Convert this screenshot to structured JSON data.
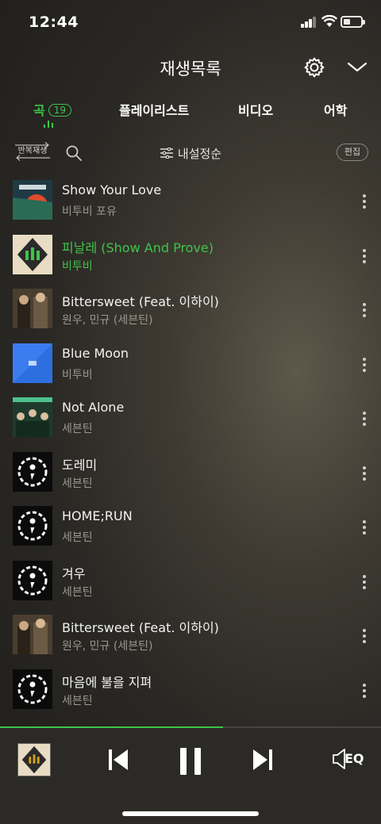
{
  "status": {
    "time": "12:44"
  },
  "header": {
    "title": "재생목록"
  },
  "tabs": [
    {
      "label": "곡",
      "count": "19"
    },
    {
      "label": "플레이리스트"
    },
    {
      "label": "비디오"
    },
    {
      "label": "어학"
    }
  ],
  "toolbar": {
    "repeat_label": "반복재생",
    "sort_label": "내설정순",
    "edit_label": "편집"
  },
  "songs": [
    {
      "title": "Show Your Love",
      "artist": "비투비 포유"
    },
    {
      "title": "피날레 (Show And Prove)",
      "artist": "비투비"
    },
    {
      "title": "Bittersweet (Feat. 이하이)",
      "artist": "원우, 민규 (세븐틴)"
    },
    {
      "title": "Blue Moon",
      "artist": "비투비"
    },
    {
      "title": "Not Alone",
      "artist": "세븐틴"
    },
    {
      "title": "도레미",
      "artist": "세븐틴"
    },
    {
      "title": "HOME;RUN",
      "artist": "세븐틴"
    },
    {
      "title": "겨우",
      "artist": "세븐틴"
    },
    {
      "title": "Bittersweet (Feat. 이하이)",
      "artist": "원우, 민규 (세븐틴)"
    },
    {
      "title": "마음에 불을 지펴",
      "artist": "세븐틴"
    }
  ],
  "player": {
    "eq_label": "EQ",
    "progress": 0.585
  },
  "colors": {
    "accent": "#3ec44a"
  }
}
